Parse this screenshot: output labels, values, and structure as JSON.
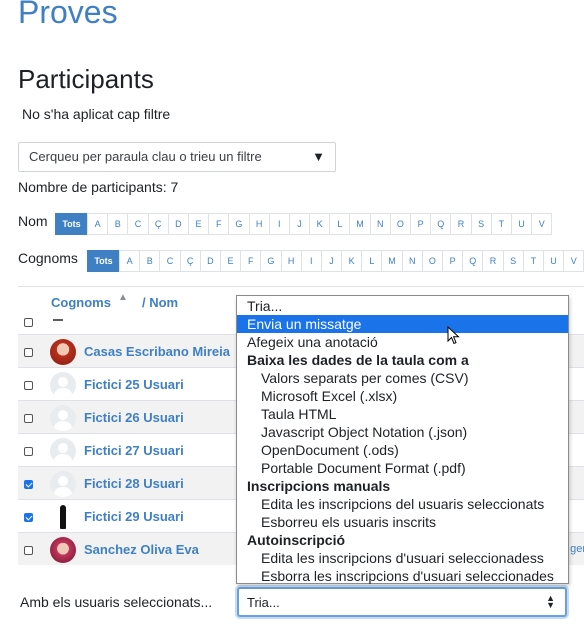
{
  "course_title": "Proves",
  "section_title": "Participants",
  "filter_status": "No s'ha aplicat cap filtre",
  "filter_select": {
    "placeholder": "Cerqueu per paraula clau o trieu un filtre"
  },
  "participant_count": "Nombre de participants: 7",
  "initials": {
    "first_name_label": "Nom",
    "last_name_label": "Cognoms",
    "all_label": "Tots",
    "letters": [
      "A",
      "B",
      "C",
      "Ç",
      "D",
      "E",
      "F",
      "G",
      "H",
      "I",
      "J",
      "K",
      "L",
      "M",
      "N",
      "O",
      "P",
      "Q",
      "R",
      "S",
      "T",
      "U",
      "V"
    ]
  },
  "table": {
    "col_surname": "Cognoms",
    "col_name": "/ Nom",
    "rows": [
      {
        "name": "Casas Escribano Mireia",
        "checked": false
      },
      {
        "name": "Fictici 25 Usuari",
        "checked": false
      },
      {
        "name": "Fictici 26 Usuari",
        "checked": false
      },
      {
        "name": "Fictici 27 Usuari",
        "checked": false
      },
      {
        "name": "Fictici 28 Usuari",
        "checked": true
      },
      {
        "name": "Fictici 29 Usuari",
        "checked": true
      },
      {
        "name": "Sanchez Oliva Eva",
        "checked": false
      }
    ],
    "clipped_text": "ger"
  },
  "bulk": {
    "label": "Amb els usuaris seleccionats...",
    "selected": "Tria...",
    "options": {
      "choose": "Tria...",
      "send_message": "Envia un missatge",
      "add_note": "Afegeix una anotació",
      "download_group": "Baixa les dades de la taula com a",
      "csv": "Valors separats per comes (CSV)",
      "xlsx": "Microsoft Excel (.xlsx)",
      "html": "Taula HTML",
      "json": "Javascript Object Notation (.json)",
      "ods": "OpenDocument (.ods)",
      "pdf": "Portable Document Format (.pdf)",
      "manual_group": "Inscripcions manuals",
      "manual_edit": "Edita les inscripcions del usuaris seleccionats",
      "manual_delete": "Esborreu els usuaris inscrits",
      "self_group": "Autoinscripció",
      "self_edit": "Edita les inscripcions d'usuari seleccionadess",
      "self_delete": "Esborra les inscripcions d'usuari seleccionades"
    }
  },
  "colors": {
    "accent": "#3f80c4",
    "highlight": "#1a73e8"
  }
}
